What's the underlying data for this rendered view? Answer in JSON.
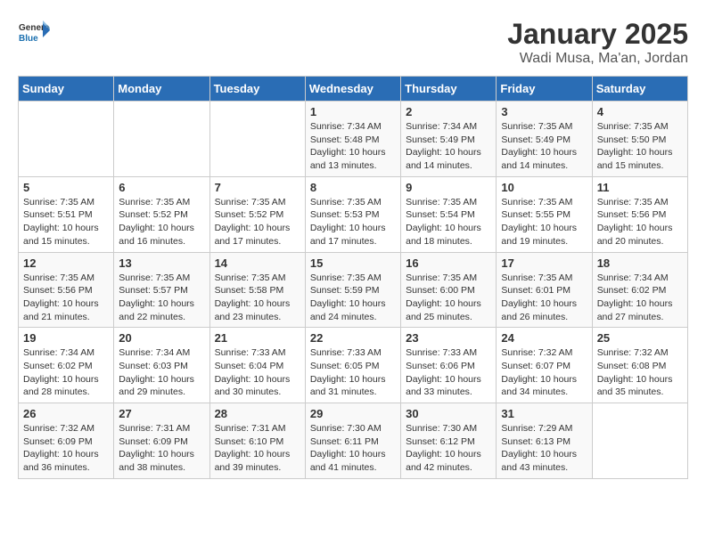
{
  "header": {
    "logo_line1": "General",
    "logo_line2": "Blue",
    "title": "January 2025",
    "subtitle": "Wadi Musa, Ma'an, Jordan"
  },
  "days_of_week": [
    "Sunday",
    "Monday",
    "Tuesday",
    "Wednesday",
    "Thursday",
    "Friday",
    "Saturday"
  ],
  "weeks": [
    [
      {
        "day": "",
        "sunrise": "",
        "sunset": "",
        "daylight": ""
      },
      {
        "day": "",
        "sunrise": "",
        "sunset": "",
        "daylight": ""
      },
      {
        "day": "",
        "sunrise": "",
        "sunset": "",
        "daylight": ""
      },
      {
        "day": "1",
        "sunrise": "Sunrise: 7:34 AM",
        "sunset": "Sunset: 5:48 PM",
        "daylight": "Daylight: 10 hours and 13 minutes."
      },
      {
        "day": "2",
        "sunrise": "Sunrise: 7:34 AM",
        "sunset": "Sunset: 5:49 PM",
        "daylight": "Daylight: 10 hours and 14 minutes."
      },
      {
        "day": "3",
        "sunrise": "Sunrise: 7:35 AM",
        "sunset": "Sunset: 5:49 PM",
        "daylight": "Daylight: 10 hours and 14 minutes."
      },
      {
        "day": "4",
        "sunrise": "Sunrise: 7:35 AM",
        "sunset": "Sunset: 5:50 PM",
        "daylight": "Daylight: 10 hours and 15 minutes."
      }
    ],
    [
      {
        "day": "5",
        "sunrise": "Sunrise: 7:35 AM",
        "sunset": "Sunset: 5:51 PM",
        "daylight": "Daylight: 10 hours and 15 minutes."
      },
      {
        "day": "6",
        "sunrise": "Sunrise: 7:35 AM",
        "sunset": "Sunset: 5:52 PM",
        "daylight": "Daylight: 10 hours and 16 minutes."
      },
      {
        "day": "7",
        "sunrise": "Sunrise: 7:35 AM",
        "sunset": "Sunset: 5:52 PM",
        "daylight": "Daylight: 10 hours and 17 minutes."
      },
      {
        "day": "8",
        "sunrise": "Sunrise: 7:35 AM",
        "sunset": "Sunset: 5:53 PM",
        "daylight": "Daylight: 10 hours and 17 minutes."
      },
      {
        "day": "9",
        "sunrise": "Sunrise: 7:35 AM",
        "sunset": "Sunset: 5:54 PM",
        "daylight": "Daylight: 10 hours and 18 minutes."
      },
      {
        "day": "10",
        "sunrise": "Sunrise: 7:35 AM",
        "sunset": "Sunset: 5:55 PM",
        "daylight": "Daylight: 10 hours and 19 minutes."
      },
      {
        "day": "11",
        "sunrise": "Sunrise: 7:35 AM",
        "sunset": "Sunset: 5:56 PM",
        "daylight": "Daylight: 10 hours and 20 minutes."
      }
    ],
    [
      {
        "day": "12",
        "sunrise": "Sunrise: 7:35 AM",
        "sunset": "Sunset: 5:56 PM",
        "daylight": "Daylight: 10 hours and 21 minutes."
      },
      {
        "day": "13",
        "sunrise": "Sunrise: 7:35 AM",
        "sunset": "Sunset: 5:57 PM",
        "daylight": "Daylight: 10 hours and 22 minutes."
      },
      {
        "day": "14",
        "sunrise": "Sunrise: 7:35 AM",
        "sunset": "Sunset: 5:58 PM",
        "daylight": "Daylight: 10 hours and 23 minutes."
      },
      {
        "day": "15",
        "sunrise": "Sunrise: 7:35 AM",
        "sunset": "Sunset: 5:59 PM",
        "daylight": "Daylight: 10 hours and 24 minutes."
      },
      {
        "day": "16",
        "sunrise": "Sunrise: 7:35 AM",
        "sunset": "Sunset: 6:00 PM",
        "daylight": "Daylight: 10 hours and 25 minutes."
      },
      {
        "day": "17",
        "sunrise": "Sunrise: 7:35 AM",
        "sunset": "Sunset: 6:01 PM",
        "daylight": "Daylight: 10 hours and 26 minutes."
      },
      {
        "day": "18",
        "sunrise": "Sunrise: 7:34 AM",
        "sunset": "Sunset: 6:02 PM",
        "daylight": "Daylight: 10 hours and 27 minutes."
      }
    ],
    [
      {
        "day": "19",
        "sunrise": "Sunrise: 7:34 AM",
        "sunset": "Sunset: 6:02 PM",
        "daylight": "Daylight: 10 hours and 28 minutes."
      },
      {
        "day": "20",
        "sunrise": "Sunrise: 7:34 AM",
        "sunset": "Sunset: 6:03 PM",
        "daylight": "Daylight: 10 hours and 29 minutes."
      },
      {
        "day": "21",
        "sunrise": "Sunrise: 7:33 AM",
        "sunset": "Sunset: 6:04 PM",
        "daylight": "Daylight: 10 hours and 30 minutes."
      },
      {
        "day": "22",
        "sunrise": "Sunrise: 7:33 AM",
        "sunset": "Sunset: 6:05 PM",
        "daylight": "Daylight: 10 hours and 31 minutes."
      },
      {
        "day": "23",
        "sunrise": "Sunrise: 7:33 AM",
        "sunset": "Sunset: 6:06 PM",
        "daylight": "Daylight: 10 hours and 33 minutes."
      },
      {
        "day": "24",
        "sunrise": "Sunrise: 7:32 AM",
        "sunset": "Sunset: 6:07 PM",
        "daylight": "Daylight: 10 hours and 34 minutes."
      },
      {
        "day": "25",
        "sunrise": "Sunrise: 7:32 AM",
        "sunset": "Sunset: 6:08 PM",
        "daylight": "Daylight: 10 hours and 35 minutes."
      }
    ],
    [
      {
        "day": "26",
        "sunrise": "Sunrise: 7:32 AM",
        "sunset": "Sunset: 6:09 PM",
        "daylight": "Daylight: 10 hours and 36 minutes."
      },
      {
        "day": "27",
        "sunrise": "Sunrise: 7:31 AM",
        "sunset": "Sunset: 6:09 PM",
        "daylight": "Daylight: 10 hours and 38 minutes."
      },
      {
        "day": "28",
        "sunrise": "Sunrise: 7:31 AM",
        "sunset": "Sunset: 6:10 PM",
        "daylight": "Daylight: 10 hours and 39 minutes."
      },
      {
        "day": "29",
        "sunrise": "Sunrise: 7:30 AM",
        "sunset": "Sunset: 6:11 PM",
        "daylight": "Daylight: 10 hours and 41 minutes."
      },
      {
        "day": "30",
        "sunrise": "Sunrise: 7:30 AM",
        "sunset": "Sunset: 6:12 PM",
        "daylight": "Daylight: 10 hours and 42 minutes."
      },
      {
        "day": "31",
        "sunrise": "Sunrise: 7:29 AM",
        "sunset": "Sunset: 6:13 PM",
        "daylight": "Daylight: 10 hours and 43 minutes."
      },
      {
        "day": "",
        "sunrise": "",
        "sunset": "",
        "daylight": ""
      }
    ]
  ]
}
